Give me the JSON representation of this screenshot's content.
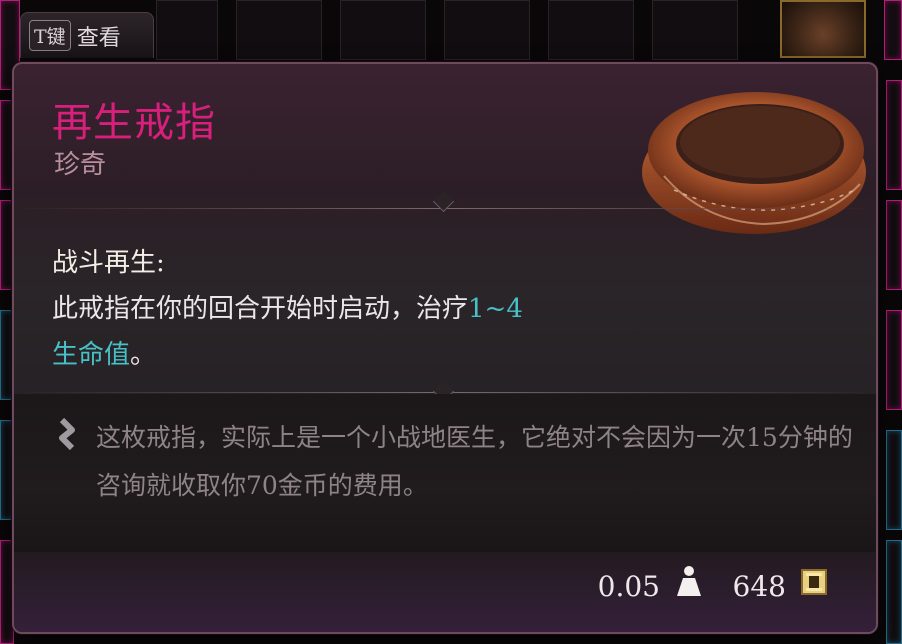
{
  "key_hint": {
    "key": "T键",
    "label": "查看"
  },
  "item": {
    "name": "再生戒指",
    "rarity": "珍奇",
    "effect": {
      "name": "战斗再生:",
      "text_before": "此戒指在你的回合开始时启动，治疗",
      "highlight_value": "1~4",
      "line_break_highlight": "生命值",
      "text_after": "。"
    },
    "flavor_text": "这枚戒指，实际上是一个小战地医生，它绝对不会因为一次15分钟的咨询就收取你70金币的费用。",
    "weight": "0.05",
    "value": "648"
  },
  "icons": {
    "ring": "ring-image",
    "quote": "quote-mark-icon",
    "weight": "weight-icon",
    "gold": "gold-coin-icon"
  },
  "colors": {
    "rarity_name": "#d81f7c",
    "highlight": "#48c0c8",
    "gold": "#e8d080"
  }
}
